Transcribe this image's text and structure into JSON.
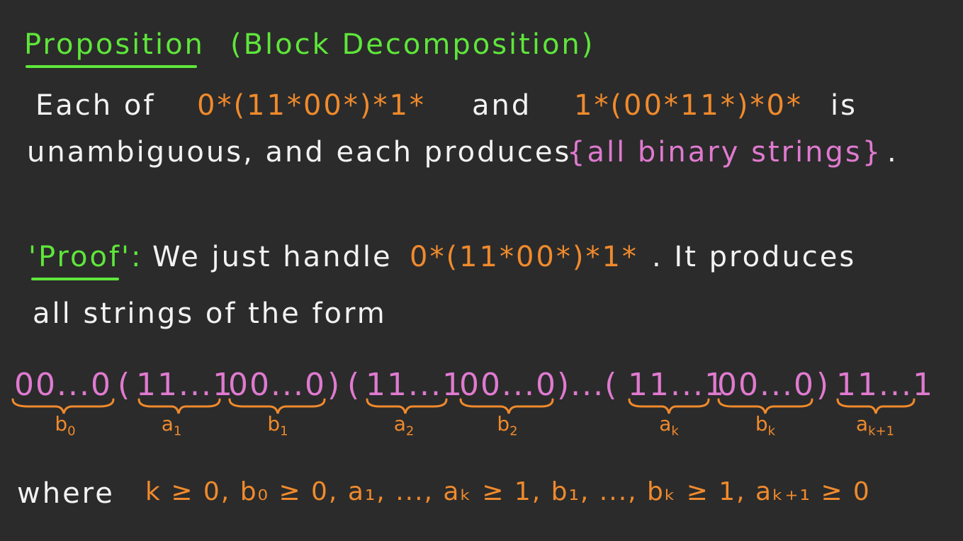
{
  "heading": {
    "title": "Proposition",
    "subtitle": "(Block Decomposition)"
  },
  "statement": {
    "line1_prefix": "Each of",
    "regex1": "0*(11*00*)*1*",
    "line1_and": "and",
    "regex2": "1*(00*11*)*0*",
    "line1_suffix": "is",
    "line2_prefix": "unambiguous, and each produces",
    "set_text": "{all binary strings}",
    "line2_suffix": "."
  },
  "proof": {
    "label": "'Proof':",
    "text1": "We just handle",
    "regex": "0*(11*00*)*1*",
    "text2": ". It produces",
    "line2": "all strings of the form"
  },
  "decomposition": {
    "segments": [
      {
        "text": "00...0",
        "color": "pink",
        "label": "b",
        "sub": "0"
      },
      {
        "text": "(",
        "color": "pink"
      },
      {
        "text": "11...1",
        "color": "pink",
        "label": "a",
        "sub": "1"
      },
      {
        "text": "00...0",
        "color": "pink",
        "label": "b",
        "sub": "1"
      },
      {
        "text": ")",
        "color": "pink"
      },
      {
        "text": "(",
        "color": "pink"
      },
      {
        "text": "11...1",
        "color": "pink",
        "label": "a",
        "sub": "2"
      },
      {
        "text": "00...0",
        "color": "pink",
        "label": "b",
        "sub": "2"
      },
      {
        "text": ")...(",
        "color": "pink"
      },
      {
        "text": "11...1",
        "color": "pink",
        "label": "a",
        "sub": "k"
      },
      {
        "text": "00...0",
        "color": "pink",
        "label": "b",
        "sub": "k"
      },
      {
        "text": ")",
        "color": "pink"
      },
      {
        "text": "11...1",
        "color": "pink",
        "label": "a",
        "sub": "k+1"
      }
    ]
  },
  "where_line": {
    "word": "where",
    "conditions": "k ≥ 0,  b₀ ≥ 0,  a₁, ..., aₖ ≥ 1,  b₁, ..., bₖ ≥ 1,  aₖ₊₁ ≥ 0"
  },
  "colors": {
    "background": "#2b2b2b",
    "green": "#5ee63a",
    "orange": "#f08a2c",
    "pink": "#e07ad0",
    "white": "#f2f2f2"
  }
}
